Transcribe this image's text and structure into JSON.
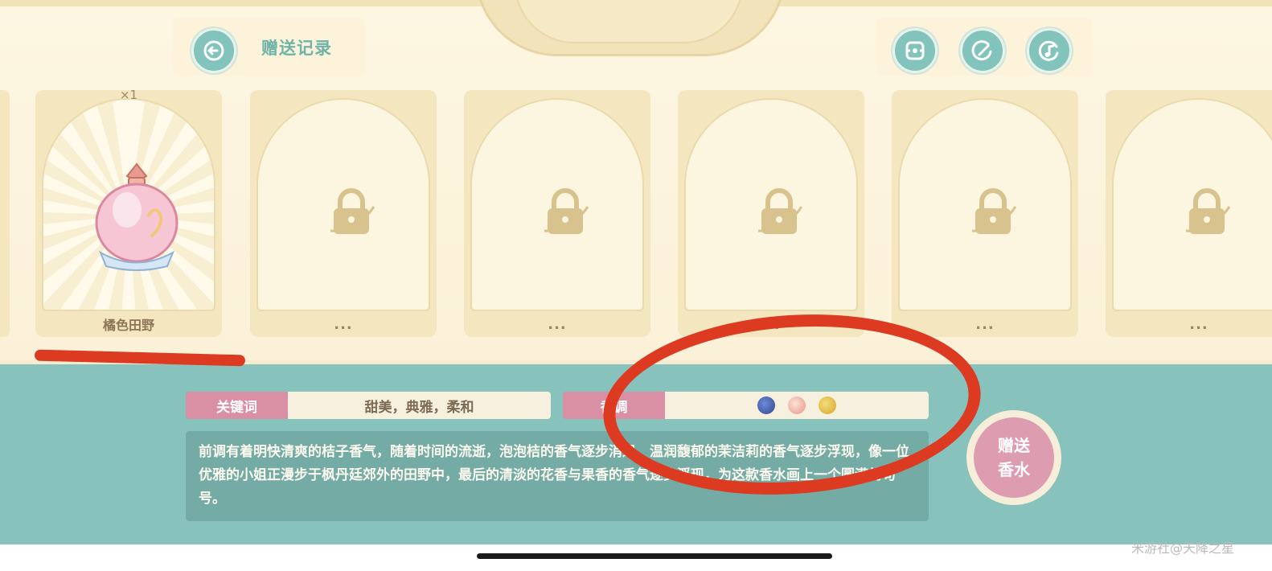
{
  "header": {
    "title": "赠送记录",
    "buttons": [
      "back-icon",
      "hide-ui-icon",
      "edit-icon",
      "music-icon"
    ]
  },
  "cards": [
    {
      "label": "橘色田野",
      "count": "×1",
      "state": "unlocked",
      "icon": "perfume-bottle-icon"
    },
    {
      "label": "...",
      "state": "locked",
      "icon": "lock-icon"
    },
    {
      "label": "...",
      "state": "locked",
      "icon": "lock-icon"
    },
    {
      "label": "...",
      "state": "locked",
      "icon": "lock-icon"
    },
    {
      "label": "...",
      "state": "locked",
      "icon": "lock-icon"
    },
    {
      "label": "...",
      "state": "locked",
      "icon": "lock-icon"
    }
  ],
  "details": {
    "keyword_label": "关键词",
    "keywords": "甜美，典雅，柔和",
    "notes_label": "香调",
    "notes": [
      "blue-flower-icon",
      "peach-blossom-icon",
      "orange-fruit-icon"
    ],
    "description": "前调有着明快清爽的桔子香气，随着时间的流逝，泡泡桔的香气逐步消退，温润馥郁的茉洁莉的香气逐步浮现，像一位优雅的小姐正漫步于枫丹廷郊外的田野中，最后的清淡的花香与果香的香气逐步浮现，为这款香水画上一个圆满的句号。"
  },
  "gift_button": {
    "line1": "赠送",
    "line2": "香水"
  },
  "watermark": "米游社@天降之星",
  "colors": {
    "teal": "#87c3bc",
    "cream": "#fdf6e2",
    "pink": "#de9cb0",
    "annotation_red": "#dd3a22"
  }
}
